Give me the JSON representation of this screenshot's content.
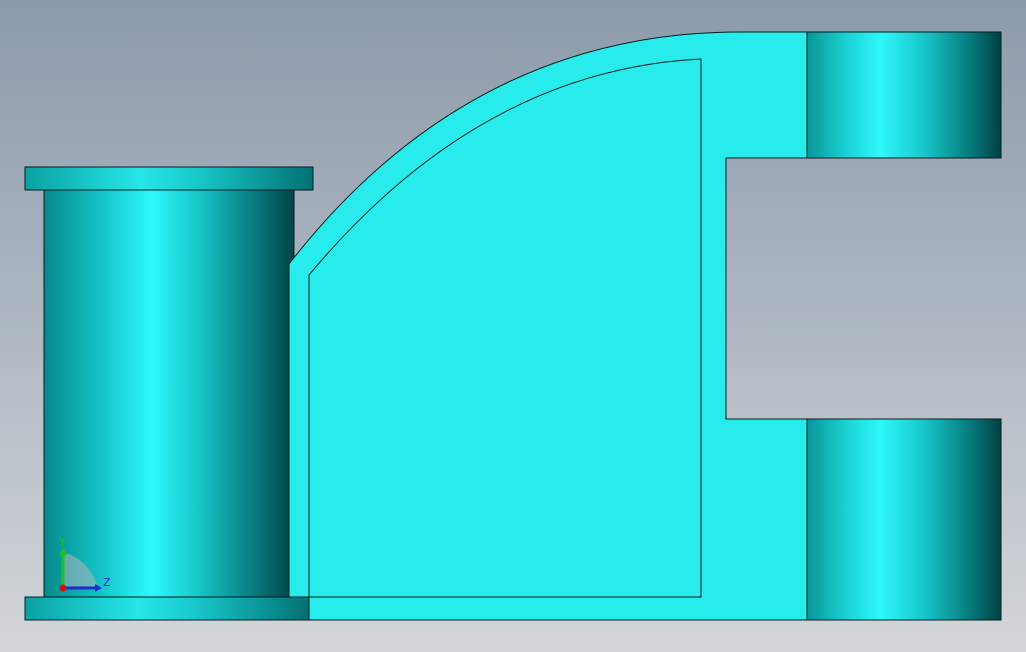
{
  "viewport": {
    "background_top": "#8b9aaa",
    "background_bottom": "#d3d6da"
  },
  "model": {
    "face_color": "#27eceb",
    "edge_color": "#00201f",
    "cyl_dark": "#014b4e",
    "cyl_mid": "#0aa9ab",
    "cyl_light": "#2ef8fb"
  },
  "triad": {
    "y_label": "Y",
    "z_label": "Z",
    "y_color": "#1fbf2a",
    "z_color": "#1b2fd0",
    "x_color": "#d01010"
  }
}
